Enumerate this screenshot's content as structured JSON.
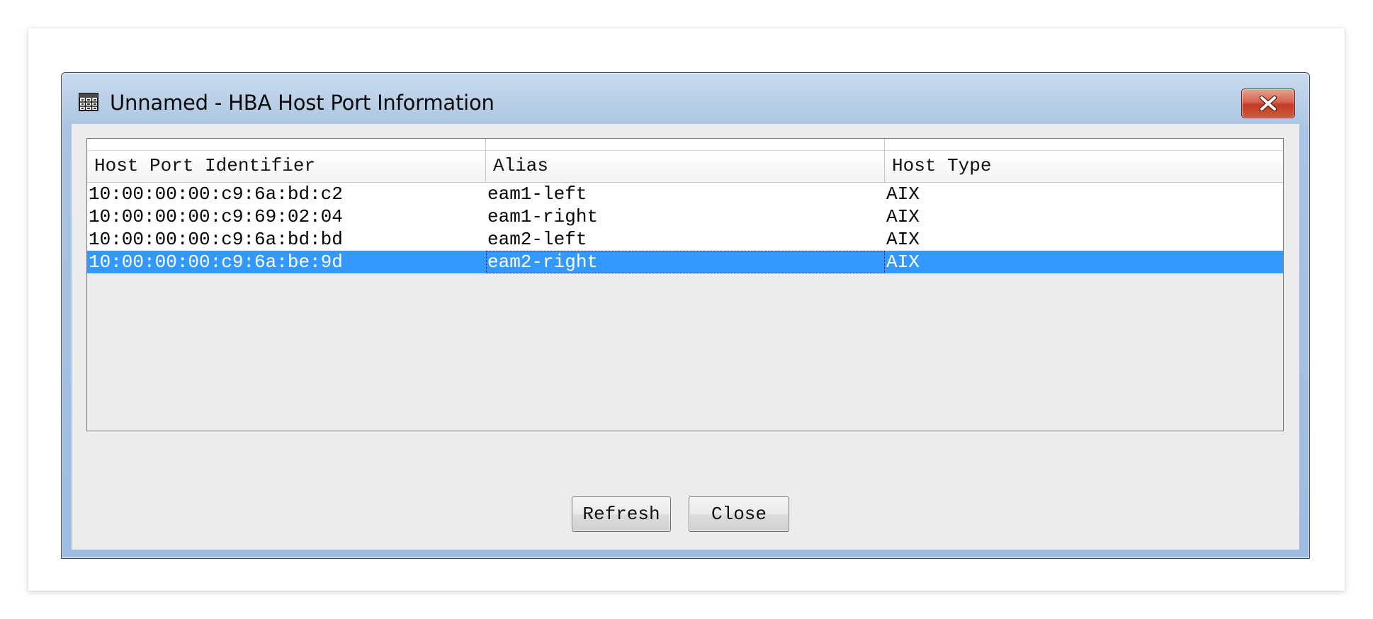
{
  "window": {
    "title": "Unnamed - HBA Host Port Information",
    "title_icon": "table-grid-icon",
    "close_icon": "close-icon",
    "close_color": "#c9432a"
  },
  "table": {
    "columns": [
      "Host Port Identifier",
      "Alias",
      "Host Type"
    ],
    "rows": [
      {
        "port": "10:00:00:00:c9:6a:bd:c2",
        "alias": "eam1-left",
        "type": "AIX"
      },
      {
        "port": "10:00:00:00:c9:69:02:04",
        "alias": "eam1-right",
        "type": "AIX"
      },
      {
        "port": "10:00:00:00:c9:6a:bd:bd",
        "alias": "eam2-left",
        "type": "AIX"
      },
      {
        "port": "10:00:00:00:c9:6a:be:9d",
        "alias": "eam2-right",
        "type": "AIX"
      }
    ],
    "selected_row": 3,
    "selection_color": "#3399ff"
  },
  "buttons": {
    "refresh": "Refresh",
    "close": "Close"
  }
}
